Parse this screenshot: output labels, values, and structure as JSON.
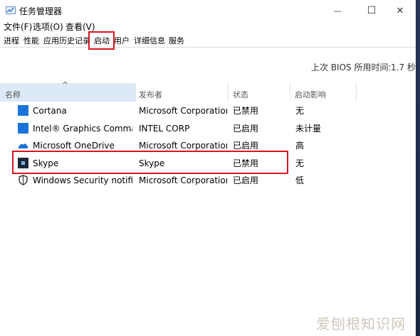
{
  "window": {
    "title": "任务管理器",
    "controls": {
      "minimize": "—",
      "maximize": "☐",
      "close": "✕"
    }
  },
  "menu": {
    "items": [
      {
        "label": "文件(F)"
      },
      {
        "label": "选项(O)"
      },
      {
        "label": "查看(V)"
      }
    ]
  },
  "tabs": [
    {
      "label": "进程"
    },
    {
      "label": "性能"
    },
    {
      "label": "应用历史记录"
    },
    {
      "label": "启动",
      "selected": true
    },
    {
      "label": "用户"
    },
    {
      "label": "详细信息"
    },
    {
      "label": "服务"
    }
  ],
  "bios": {
    "label": "上次 BIOS 所用时间:",
    "value": "1.7 秒"
  },
  "table": {
    "sort_indicator": "^",
    "columns": [
      {
        "label": "名称"
      },
      {
        "label": "发布者"
      },
      {
        "label": "状态"
      },
      {
        "label": "启动影响"
      }
    ],
    "rows": [
      {
        "name": "Cortana",
        "publisher": "Microsoft Corporation",
        "status": "已禁用",
        "impact": "无",
        "icon": "cortana-icon"
      },
      {
        "name": "Intel® Graphics Comman...",
        "publisher": "INTEL CORP",
        "status": "已启用",
        "impact": "未计量",
        "icon": "intel-graphics-icon"
      },
      {
        "name": "Microsoft OneDrive",
        "publisher": "Microsoft Corporation",
        "status": "已启用",
        "impact": "高",
        "icon": "onedrive-icon"
      },
      {
        "name": "Skype",
        "publisher": "Skype",
        "status": "已禁用",
        "impact": "无",
        "icon": "skype-icon"
      },
      {
        "name": "Windows Security notifica...",
        "publisher": "Microsoft Corporation",
        "status": "已启用",
        "impact": "低",
        "icon": "shield-icon"
      }
    ]
  },
  "watermark": {
    "text": "爱刨根知识网"
  },
  "colors": {
    "highlight": "#d9141e",
    "sorted_header": "#dce9f6",
    "accent_blue": "#1a73d9"
  }
}
